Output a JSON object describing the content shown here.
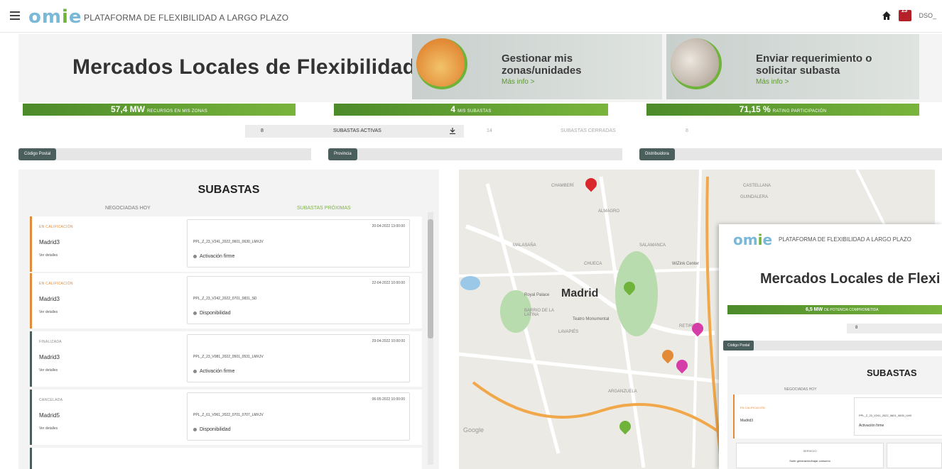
{
  "header": {
    "logo_text": "omie",
    "title": "PLATAFORMA DE FLEXIBILIDAD A LARGO PLAZO",
    "notifications": "13",
    "user": "DSO_"
  },
  "hero": {
    "title": "Mercados Locales de Flexibilidad",
    "cards": [
      {
        "title_line1": "Gestionar mis",
        "title_line2": "zonas/unidades",
        "link": "Más info >"
      },
      {
        "title_line1": "Enviar requerimiento o",
        "title_line2": "solicitar subasta",
        "link": "Más info >"
      }
    ]
  },
  "stats": [
    {
      "value": "57,4 MW",
      "label": "RECURSOS EN MIS ZONAS"
    },
    {
      "value": "4",
      "label": "MIS SUBASTAS"
    },
    {
      "value": "71,15 %",
      "label": "RATING PARTICIPACIÓN"
    }
  ],
  "tabs": {
    "active_count": "8",
    "active_label": "SUBASTAS ACTIVAS",
    "closed_count": "14",
    "closed_label": "SUBASTAS CERRADAS",
    "extra_count": "8"
  },
  "filters": [
    "Código Postal",
    "Provincia",
    "Distribuidora"
  ],
  "panel": {
    "title": "SUBASTAS",
    "tab_today": "NEGOCIADAS HOY",
    "tab_next": "SUBASTAS PRÓXIMAS",
    "details_label": "Ver detalles",
    "auctions": [
      {
        "status": "EN CALIFICACIÓN",
        "zone": "Madrid3",
        "date": "20-04-2022 13:00:00",
        "code": "PPL_Z_23_V241_2022_0601_0630_LMXJV",
        "type": "Activación firme"
      },
      {
        "status": "EN CALIFICACIÓN",
        "zone": "Madrid3",
        "date": "22-04-2022 10:00:00",
        "code": "PPL_Z_23_V242_2022_0701_0831_SD",
        "type": "Disponibilidad"
      },
      {
        "status": "FINALIZADA",
        "zone": "Madrid3",
        "date": "29-04-2022 10:00:00",
        "code": "PPL_Z_23_V081_2022_0501_0531_LMXJV",
        "type": "Activación firme"
      },
      {
        "status": "CANCELADA",
        "zone": "Madrid5",
        "date": "06-05-2022 10:00:00",
        "code": "PPL_Z_61_V061_2022_0701_0707_LMXJV",
        "type": "Disponibilidad"
      }
    ]
  },
  "map": {
    "city": "Madrid",
    "labels": [
      "CHAMBERÍ",
      "ALMAGRO",
      "MALASAÑA",
      "SALAMANCA",
      "CHUECA",
      "Royal Palace",
      "BARRIO DE LA LATINA",
      "Teatro Monumental",
      "LAVAPIÉS",
      "ARGANZUELA",
      "RETIRO",
      "CASTELLANA",
      "GUINDALERA",
      "WiZink Center",
      "Google"
    ]
  },
  "overlay": {
    "logo_text": "omie",
    "title_bar": "PLATAFORMA DE FLEXIBILIDAD A LARGO PLAZO",
    "title": "Mercados Locales de Flexi",
    "stat_value": "6,5 MW",
    "stat_label": "DE POTENCIA COMPROMETIDA",
    "tab_count": "8",
    "filter": "Código Postal",
    "subastas": "SUBASTAS",
    "tab_today": "NEGOCIADAS HOY",
    "auction_status": "EN CALIFICACIÓN",
    "auction_zone": "Madrid3",
    "auction_code": "PPL_Z_23_V241_2022_0601_0630_LMX",
    "auction_type": "Activación firme",
    "bottom_label": "SERVICIO",
    "bottom_value": "Subir generación/bajar consumo"
  },
  "colors": {
    "accent_green": "#6fb33a",
    "orange": "#e38a36",
    "dark_teal": "#4a5e5c"
  }
}
